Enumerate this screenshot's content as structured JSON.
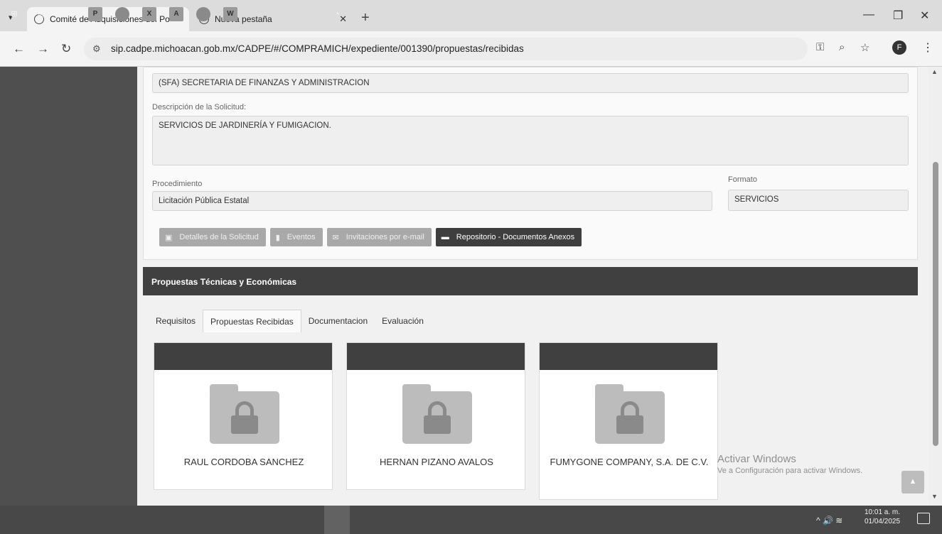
{
  "browser": {
    "tabs": [
      {
        "title": "Comité de Adquisiciones del Po",
        "active": true
      },
      {
        "title": "Nueva pestaña",
        "active": false
      }
    ],
    "url": "sip.cadpe.michoacan.gob.mx/CADPE/#/COMPRAMICH/expediente/001390/propuestas/recibidas"
  },
  "form": {
    "dependencia_value": "(SFA)  SECRETARIA DE FINANZAS Y ADMINISTRACION",
    "descripcion_label": "Descripción de la Solicitud:",
    "descripcion_value": "SERVICIOS DE JARDINERÍA Y FUMIGACION.",
    "procedimiento_label": "Procedimiento",
    "procedimiento_value": "Licitación Pública Estatal",
    "formato_label": "Formato",
    "formato_value": "SERVICIOS"
  },
  "buttons": {
    "detalles": "Detalles de la Solicitud",
    "eventos": "Eventos",
    "invitaciones": "Invitaciones por e-mail",
    "repositorio": "Repositorio - Documentos Anexos"
  },
  "section": {
    "title": "Propuestas Técnicas y Económicas",
    "tabs": [
      "Requisitos",
      "Propuestas Recibidas",
      "Documentacion",
      "Evaluación"
    ],
    "active_tab": "Propuestas Recibidas"
  },
  "proposals": [
    {
      "name": "RAUL CORDOBA SANCHEZ",
      "icon": "locked-folder-icon"
    },
    {
      "name": "HERNAN PIZANO AVALOS",
      "icon": "locked-folder-icon"
    },
    {
      "name": "FUMYGONE COMPANY, S.A. DE C.V.",
      "icon": "locked-folder-icon"
    }
  ],
  "watermark": {
    "title": "Activar Windows",
    "subtitle": "Ve a Configuración para activar Windows."
  },
  "taskbar": {
    "time": "10:01 a. m.",
    "date": "01/04/2025"
  }
}
